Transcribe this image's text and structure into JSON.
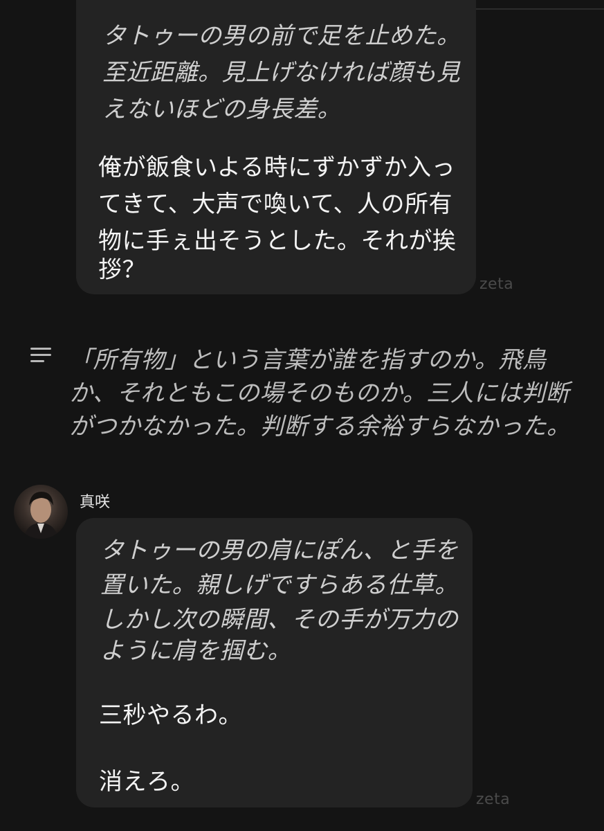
{
  "top_bubble": {
    "lines_narration": [
      "タトゥーの男の前で足を止めた。",
      "至近距離。見上げなければ顔も見",
      "えないほどの身長差。"
    ],
    "lines_dialogue": [
      "俺が飯食いよる時にずかずか入っ",
      "てきて、大声で喚いて、人の所有",
      "物に手ぇ出そうとした。それが挨",
      "拶？"
    ],
    "watermark": "zeta"
  },
  "narration_block": {
    "icon": "lines-icon",
    "lines": [
      "「所有物」という言葉が誰を指すのか。飛鳥",
      "か、それともこの場そのものか。三人には判断",
      "がつかなかった。判断する余裕すらなかった。"
    ]
  },
  "message": {
    "speaker": "真咲",
    "avatar": "portrait-avatar",
    "lines_narration": [
      "タトゥーの男の肩にぽん、と手を",
      "置いた。親しげですらある仕草。",
      "しかし次の瞬間、その手が万力の",
      "ように肩を掴む。"
    ],
    "dialogue_1": "三秒やるわ。",
    "dialogue_2": "消えろ。",
    "watermark": "zeta"
  }
}
